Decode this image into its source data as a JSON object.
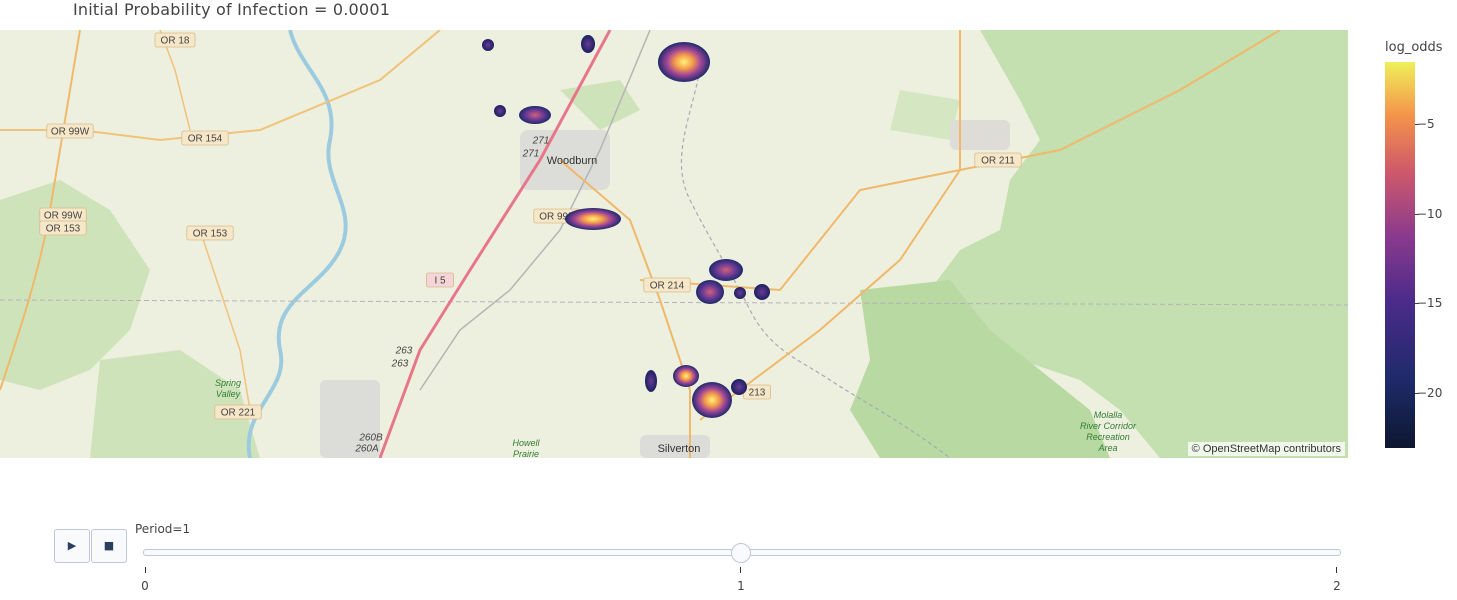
{
  "title": "Initial Probability of Infection = 0.0001",
  "map": {
    "attribution": "© OpenStreetMap contributors",
    "road_labels": [
      "OR 18",
      "OR 99W",
      "OR 154",
      "OR 99W",
      "OR 153",
      "OR 153",
      "OR 221",
      "I 5",
      "I 5",
      "OR 99E",
      "OR 214",
      "OR 211",
      "213",
      "271",
      "271",
      "263",
      "263",
      "260B",
      "260A"
    ],
    "city_labels": [
      "Woodburn",
      "Silverton",
      "Howell Prairie",
      "Spring Valley"
    ],
    "park_labels": [
      "Molalla",
      "River Corridor",
      "Recreation",
      "Area"
    ]
  },
  "colorbar": {
    "title": "log_odds",
    "ticks": [
      "−5",
      "−10",
      "−15",
      "−20"
    ],
    "gradient": [
      "#0d1730",
      "#1f2a6b",
      "#4b2b8a",
      "#8b3a8d",
      "#d05a6a",
      "#f3934a",
      "#f0f05a"
    ]
  },
  "animation": {
    "play_icon": "play-icon",
    "stop_icon": "stop-icon",
    "play_label": "▶",
    "stop_label": "■",
    "current_label": "Period=1",
    "steps": [
      "0",
      "1",
      "2"
    ],
    "current_step": 1
  }
}
